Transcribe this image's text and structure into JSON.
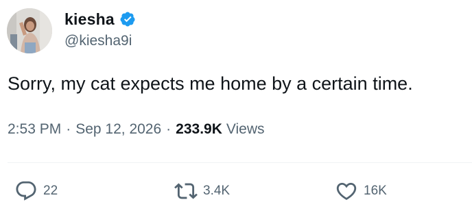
{
  "author": {
    "display_name": "kiesha",
    "handle": "@kiesha9i",
    "verified": true,
    "avatar_icon": "profile-photo",
    "verified_color": "#1d9bf0"
  },
  "tweet": {
    "text": "Sorry, my cat expects me home by a certain time."
  },
  "meta": {
    "time": "2:53 PM",
    "separator": "·",
    "date": "Sep 12, 2026",
    "views_count": "233.9K",
    "views_label": "Views"
  },
  "actions": {
    "reply": {
      "icon": "reply-icon",
      "count": "22"
    },
    "repost": {
      "icon": "repost-icon",
      "count": "3.4K"
    },
    "like": {
      "icon": "heart-icon",
      "count": "16K"
    }
  },
  "colors": {
    "text_primary": "#0f1419",
    "text_secondary": "#536471",
    "divider": "#eff3f4"
  }
}
